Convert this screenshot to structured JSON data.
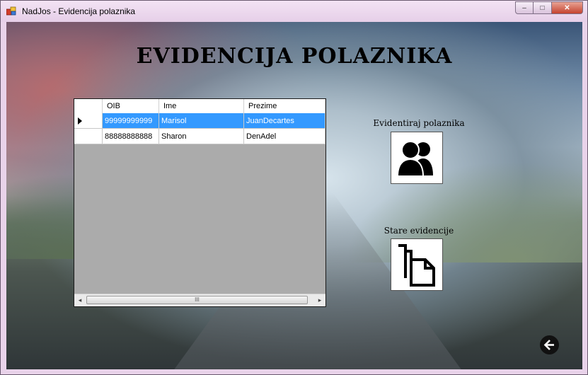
{
  "window": {
    "title": "NadJos - Evidencija polaznika",
    "controls": {
      "minimize": "–",
      "maximize": "□",
      "close": "✕"
    }
  },
  "heading": "EVIDENCIJA POLAZNIKA",
  "grid": {
    "columns": [
      "OIB",
      "Ime",
      "Prezime"
    ],
    "rows": [
      {
        "oib": "99999999999",
        "ime": "Marisol",
        "prezime": "JuanDecartes",
        "selected": true
      },
      {
        "oib": "88888888888",
        "ime": "Sharon",
        "prezime": "DenAdel",
        "selected": false
      }
    ],
    "scrollbar": {
      "left_arrow": "◂",
      "right_arrow": "▸",
      "thumb_grip": "III"
    },
    "colors": {
      "selection": "#3399ff",
      "background": "#ababab"
    }
  },
  "actions": {
    "register": {
      "label": "Evidentiraj polaznika",
      "icon": "users-icon"
    },
    "history": {
      "label": "Stare evidencije",
      "icon": "copy-documents-icon"
    }
  },
  "back": {
    "icon": "arrow-left-circle-icon"
  }
}
